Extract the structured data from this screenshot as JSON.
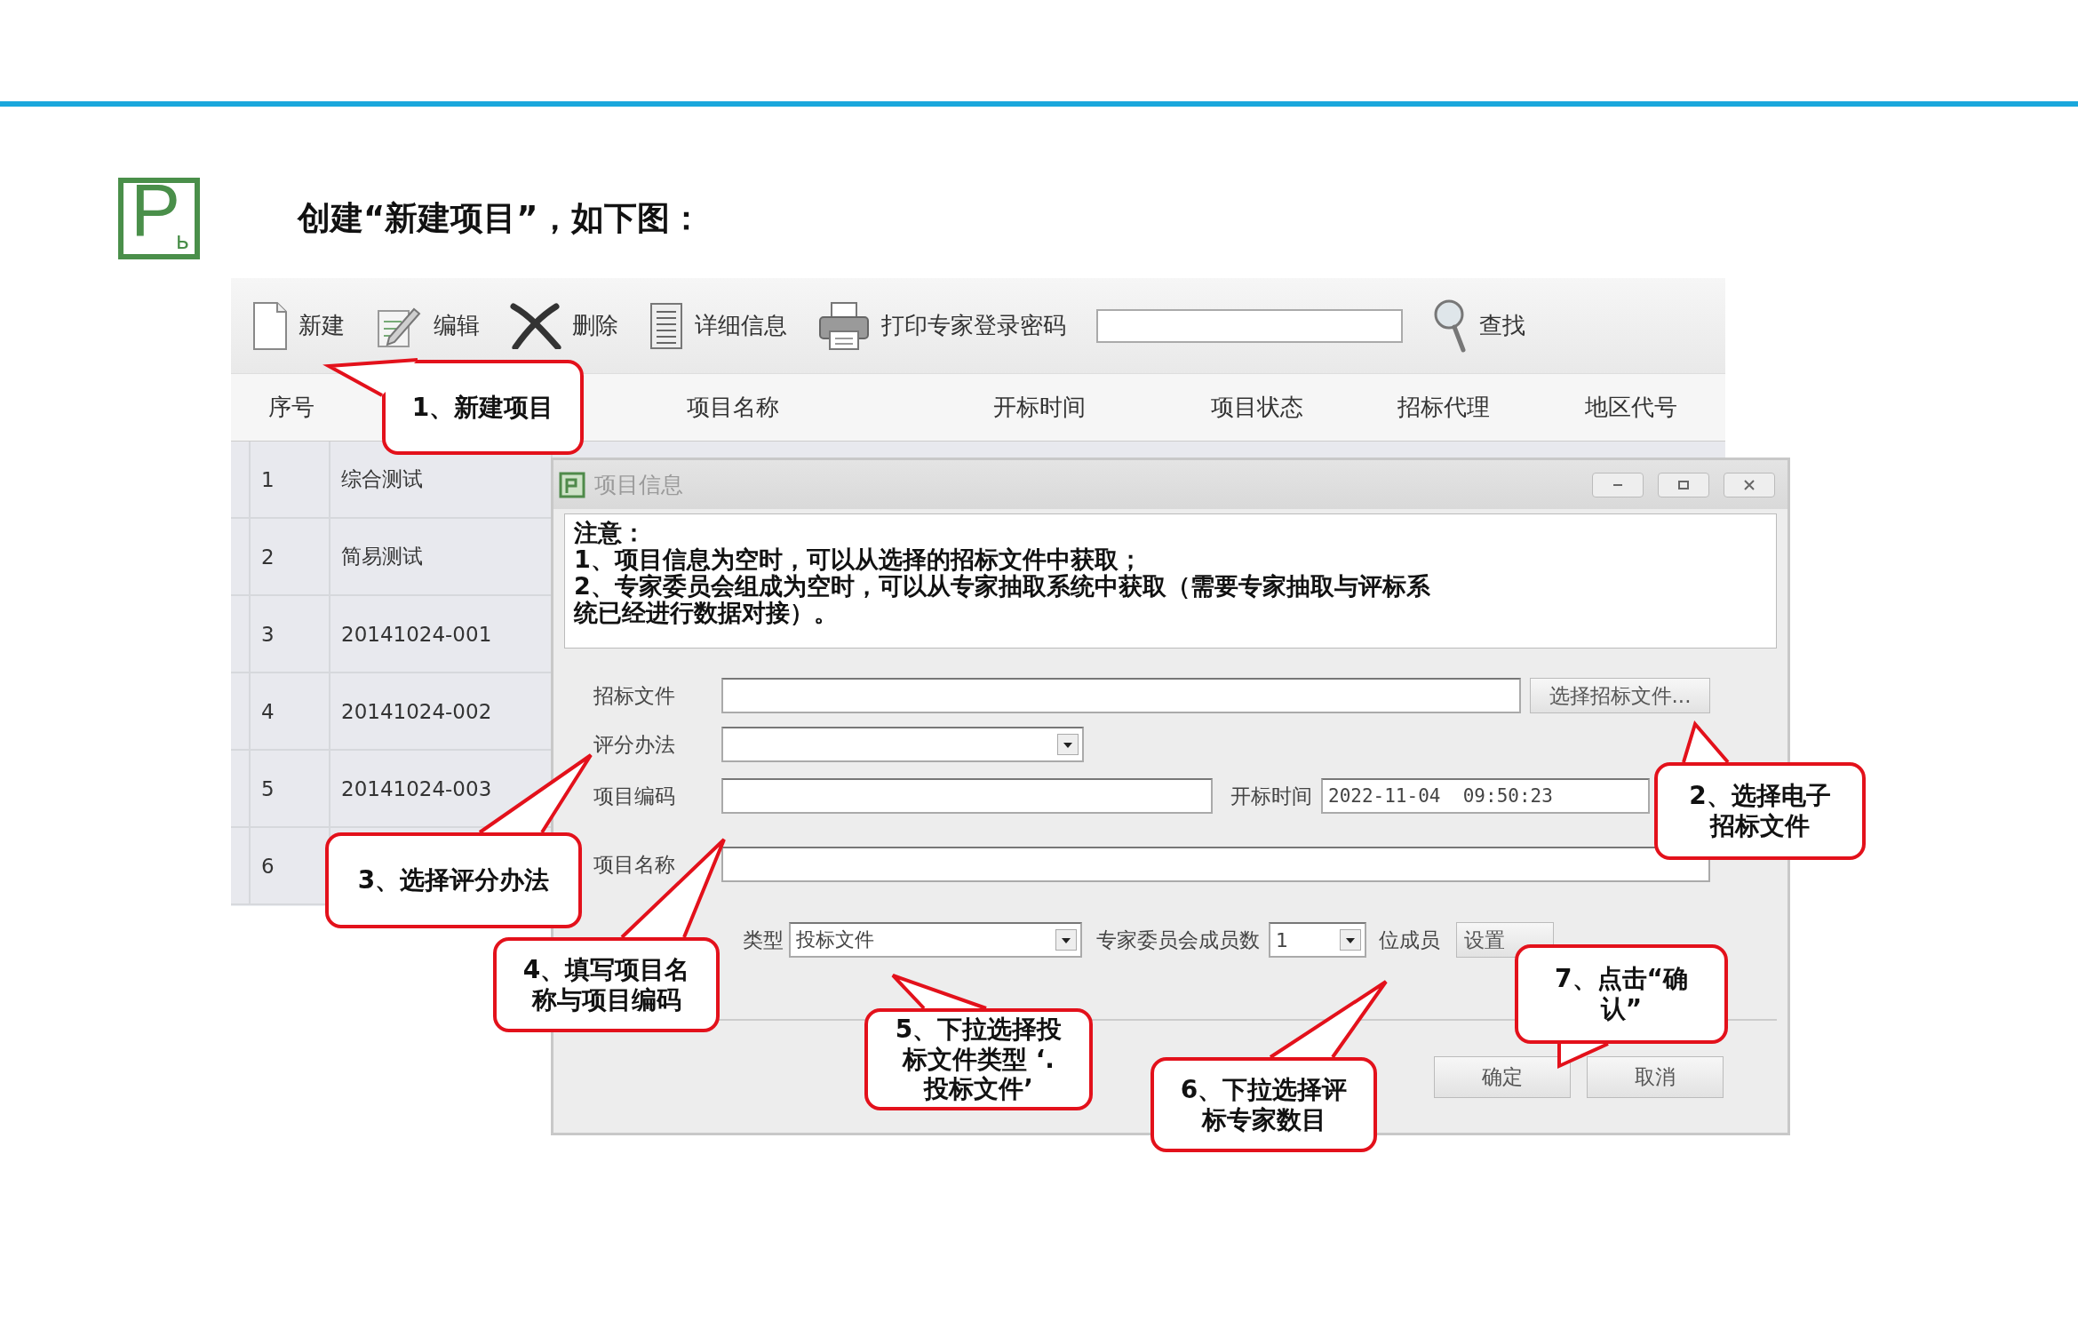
{
  "logo": {
    "main": "P",
    "sub": "ь"
  },
  "heading": "创建“新建项目”，如下图：",
  "toolbar": {
    "buttons": [
      {
        "kind": "new",
        "label": "新建"
      },
      {
        "kind": "edit",
        "label": "编辑"
      },
      {
        "kind": "delete",
        "label": "删除"
      },
      {
        "kind": "details",
        "label": "详细信息"
      },
      {
        "kind": "print",
        "label": "打印专家登录密码"
      }
    ],
    "search_button": "查找"
  },
  "table": {
    "columns": [
      "序号",
      "项目名称",
      "开标时间",
      "项目状态",
      "招标代理",
      "地区代号"
    ],
    "rows": [
      {
        "index": "1",
        "name": "综合测试"
      },
      {
        "index": "2",
        "name": "简易测试"
      },
      {
        "index": "3",
        "name": "20141024-001"
      },
      {
        "index": "4",
        "name": "20141024-002"
      },
      {
        "index": "5",
        "name": "20141024-003"
      },
      {
        "index": "6"
      }
    ]
  },
  "dialog": {
    "title": "项目信息",
    "notice": [
      "注意：",
      "1、项目信息为空时，可以从选择的招标文件中获取；",
      "2、专家委员会组成为空时，可以从专家抽取系统中获取（需要专家抽取与评标系",
      "统已经进行数据对接）。"
    ],
    "fields": {
      "tender_file": {
        "label": "招标文件",
        "button": "选择招标文件..."
      },
      "scoring_method": {
        "label": "评分办法"
      },
      "project_code": {
        "label": "项目编码"
      },
      "open_time": {
        "label": "开标时间",
        "value": "2022-11-04  09:50:23"
      },
      "project_name": {
        "label": "项目名称"
      },
      "file_type": {
        "label": "类型",
        "value": "投标文件"
      },
      "committee_size": {
        "label": "专家委员会成员数",
        "value": "1",
        "suffix": "位成员",
        "button": "设置"
      }
    },
    "buttons": [
      "确定",
      "取消"
    ]
  },
  "callouts": [
    "1、新建项目",
    "2、选择电子招标文件",
    "3、选择评分办法",
    "4、填写项目名称与项目编码",
    "5、下拉选择投标文件类型 ‘. 投标文件’",
    "6、下拉选择评标专家数目",
    "7、点击“确认”"
  ]
}
